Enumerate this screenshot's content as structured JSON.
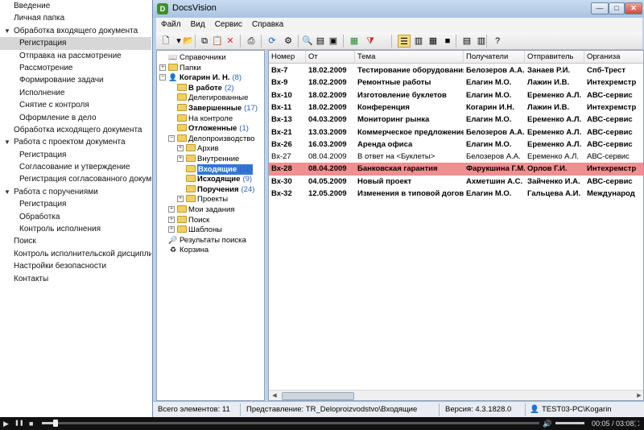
{
  "nav": {
    "items": [
      {
        "label": "Введение",
        "level": 0
      },
      {
        "label": "Личная папка",
        "level": 0
      },
      {
        "label": "Обработка входящего документа",
        "level": 0,
        "expanded": true
      },
      {
        "label": "Регистрация",
        "level": 1,
        "selected": true
      },
      {
        "label": "Отправка на рассмотрение",
        "level": 1
      },
      {
        "label": "Рассмотрение",
        "level": 1
      },
      {
        "label": "Формирование задачи",
        "level": 1
      },
      {
        "label": "Исполнение",
        "level": 1
      },
      {
        "label": "Снятие с контроля",
        "level": 1
      },
      {
        "label": "Оформление в дело",
        "level": 1
      },
      {
        "label": "Обработка исходящего документа",
        "level": 0
      },
      {
        "label": "Работа с проектом документа",
        "level": 0,
        "expanded": true
      },
      {
        "label": "Регистрация",
        "level": 1
      },
      {
        "label": "Согласование и утверждение",
        "level": 1
      },
      {
        "label": "Регистрация согласованного документа",
        "level": 1
      },
      {
        "label": "Работа с поручениями",
        "level": 0,
        "expanded": true
      },
      {
        "label": "Регистрация",
        "level": 1
      },
      {
        "label": "Обработка",
        "level": 1
      },
      {
        "label": "Контроль исполнения",
        "level": 1
      },
      {
        "label": "Поиск",
        "level": 0
      },
      {
        "label": "Контроль исполнительской дисциплины",
        "level": 0
      },
      {
        "label": "Настройки безопасности",
        "level": 0
      },
      {
        "label": "Контакты",
        "level": 0
      }
    ],
    "expand_glyph": "▼"
  },
  "window": {
    "title": "DocsVision",
    "app_icon_letter": "D",
    "controls": {
      "minimize": "—",
      "maximize": "□",
      "close": "✕"
    }
  },
  "menu": [
    "Файл",
    "Вид",
    "Сервис",
    "Справка"
  ],
  "toolbar_icons": [
    {
      "name": "new-document-icon",
      "glyph": "🗋"
    },
    {
      "name": "dropdown-arrow-icon",
      "glyph": "▾"
    },
    {
      "name": "open-folder-icon",
      "glyph": "📂"
    },
    {
      "name": "copy-icon",
      "glyph": "⧉"
    },
    {
      "name": "paste-icon",
      "glyph": "📋"
    },
    {
      "name": "delete-icon",
      "glyph": "✕",
      "color": "#d22"
    },
    {
      "name": "print-icon",
      "glyph": "⎙"
    },
    {
      "name": "refresh-icon",
      "glyph": "⟳",
      "color": "#1a5fc2"
    },
    {
      "name": "properties-icon",
      "glyph": "⚙"
    },
    {
      "name": "search-icon",
      "glyph": "🔍"
    },
    {
      "name": "preview-icon",
      "glyph": "▤"
    },
    {
      "name": "image-icon",
      "glyph": "▣"
    },
    {
      "name": "export-excel-icon",
      "glyph": "▦",
      "color": "#1f8a2a"
    },
    {
      "name": "filter-icon",
      "glyph": "⧩",
      "color": "#c22"
    },
    {
      "name": "view-list-icon",
      "glyph": "☰"
    },
    {
      "name": "view-details-icon",
      "glyph": "▥"
    },
    {
      "name": "view-preview-icon",
      "glyph": "▦"
    },
    {
      "name": "view-comment-icon",
      "glyph": "■"
    },
    {
      "name": "columns-icon",
      "glyph": "▤"
    },
    {
      "name": "rows-icon",
      "glyph": "▥"
    },
    {
      "name": "help-icon",
      "glyph": "?"
    }
  ],
  "tree": {
    "nodes": [
      {
        "label": "Справочники",
        "count": "",
        "depth": 0,
        "icon": "book-icon",
        "exp": ""
      },
      {
        "label": "Папки",
        "count": "",
        "depth": 0,
        "icon": "folder-icon",
        "exp": "+"
      },
      {
        "label": "Когарин И. Н.",
        "count": "(8)",
        "depth": 0,
        "icon": "user-folder-icon",
        "exp": "−",
        "bold": true
      },
      {
        "label": "В работе",
        "count": "(2)",
        "depth": 1,
        "icon": "folder-icon",
        "exp": "",
        "bold": true
      },
      {
        "label": "Делегированные",
        "count": "",
        "depth": 1,
        "icon": "folder-icon",
        "exp": ""
      },
      {
        "label": "Завершенные",
        "count": "(17)",
        "depth": 1,
        "icon": "folder-icon",
        "exp": "",
        "bold": true
      },
      {
        "label": "На контроле",
        "count": "",
        "depth": 1,
        "icon": "folder-icon",
        "exp": ""
      },
      {
        "label": "Отложенные",
        "count": "(1)",
        "depth": 1,
        "icon": "folder-icon",
        "exp": "",
        "bold": true
      },
      {
        "label": "Делопроизводство",
        "count": "",
        "depth": 1,
        "icon": "folder-icon",
        "exp": "−"
      },
      {
        "label": "Архив",
        "count": "",
        "depth": 2,
        "icon": "folder-icon",
        "exp": "+"
      },
      {
        "label": "Внутренние",
        "count": "",
        "depth": 2,
        "icon": "folder-icon",
        "exp": "+"
      },
      {
        "label": "Входящие",
        "count": "(11)",
        "depth": 2,
        "icon": "folder-icon",
        "exp": "",
        "bold": true,
        "selected": true
      },
      {
        "label": "Исходящие",
        "count": "(9)",
        "depth": 2,
        "icon": "folder-icon",
        "exp": "",
        "bold": true
      },
      {
        "label": "Поручения",
        "count": "(24)",
        "depth": 2,
        "icon": "folder-icon",
        "exp": "",
        "bold": true
      },
      {
        "label": "Проекты",
        "count": "",
        "depth": 2,
        "icon": "folder-icon",
        "exp": "+"
      },
      {
        "label": "Мои задания",
        "count": "",
        "depth": 1,
        "icon": "folder-icon",
        "exp": "+"
      },
      {
        "label": "Поиск",
        "count": "",
        "depth": 1,
        "icon": "folder-icon",
        "exp": "+"
      },
      {
        "label": "Шаблоны",
        "count": "",
        "depth": 1,
        "icon": "folder-icon",
        "exp": "+"
      },
      {
        "label": "Результаты поиска",
        "count": "",
        "depth": 0,
        "icon": "search-results-icon",
        "exp": ""
      },
      {
        "label": "Корзина",
        "count": "",
        "depth": 0,
        "icon": "recycle-bin-icon",
        "exp": ""
      }
    ]
  },
  "grid": {
    "columns": [
      "Номер",
      "От",
      "Тема",
      "Получатели",
      "Отправитель",
      "Организа"
    ],
    "rows": [
      {
        "cells": [
          "Вх-7",
          "18.02.2009",
          "Тестирование оборудования",
          "Белозеров А.А.",
          "Занаев Р.И.",
          "Спб-Трест"
        ],
        "bold": true
      },
      {
        "cells": [
          "Вх-9",
          "18.02.2009",
          "Ремонтные работы",
          "Елагин М.О.",
          "Лажин И.В.",
          "Интехремстр"
        ],
        "bold": true
      },
      {
        "cells": [
          "Вх-10",
          "18.02.2009",
          "Изготовление буклетов",
          "Елагин М.О.",
          "Еременко А.Л.",
          "АВС-сервис"
        ],
        "bold": true
      },
      {
        "cells": [
          "Вх-11",
          "18.02.2009",
          "Конференция",
          "Когарин И.Н.",
          "Лажин И.В.",
          "Интехремстр"
        ],
        "bold": true
      },
      {
        "cells": [
          "Вх-13",
          "04.03.2009",
          "Мониторинг рынка",
          "Елагин М.О.",
          "Еременко А.Л.",
          "АВС-сервис"
        ],
        "bold": true
      },
      {
        "cells": [
          "Вх-21",
          "13.03.2009",
          "Коммерческое предложение",
          "Белозеров А.А.",
          "Еременко А.Л.",
          "АВС-сервис"
        ],
        "bold": true
      },
      {
        "cells": [
          "Вх-26",
          "16.03.2009",
          "Аренда офиса",
          "Елагин М.О.",
          "Еременко А.Л.",
          "АВС-сервис"
        ],
        "bold": true
      },
      {
        "cells": [
          "Вх-27",
          "08.04.2009",
          "В ответ на <Буклеты>",
          "Белозеров А.А.",
          "Еременко А.Л.",
          "АВС-сервис"
        ],
        "bold": false
      },
      {
        "cells": [
          "Вх-28",
          "08.04.2009",
          "Банковская гарантия",
          "Фарукшина Г.М.",
          "Орлов Г.И.",
          "Интехремстр"
        ],
        "bold": true,
        "highlight": true
      },
      {
        "cells": [
          "Вх-30",
          "04.05.2009",
          "Новый проект",
          "Ахметшин А.С.",
          "Зайченко И.А.",
          "АВС-сервис"
        ],
        "bold": true
      },
      {
        "cells": [
          "Вх-32",
          "12.05.2009",
          "Изменения в типовой договор",
          "Елагин М.О.",
          "Гальцева А.И.",
          "Международ"
        ],
        "bold": true
      }
    ]
  },
  "status": {
    "count": "Всего элементов: 11",
    "view": "Представление: TR_Deloproizvodstvo\\Входящие",
    "version": "Версия: 4.3.1828.0",
    "user": "TEST03-PC\\Kogarin"
  },
  "player": {
    "time": "00:05 / 03:08",
    "progress": 0.027,
    "play_glyph": "▶",
    "pause_glyph": "❚❚",
    "stop_glyph": "■",
    "volume_glyph": "🔊",
    "fullscreen_glyph": "⛶"
  },
  "colors": {
    "highlight_row": "#f08f8f",
    "selected_tree": "#3278d6",
    "count_blue": "#2a5fbf",
    "nav_selected": "#d7d7d7"
  }
}
